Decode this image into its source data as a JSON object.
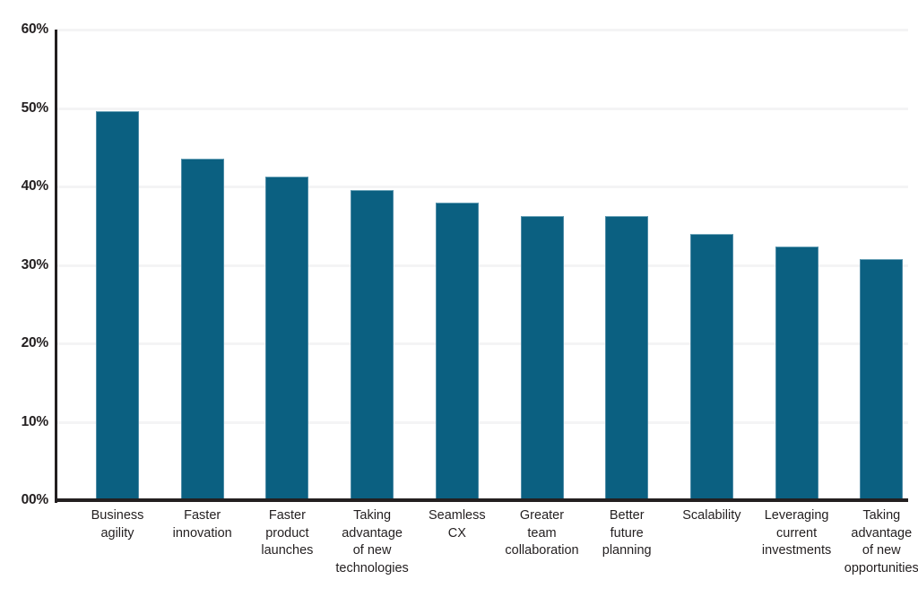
{
  "chart_data": {
    "type": "bar",
    "title": "",
    "subtitle": "",
    "xlabel": "",
    "ylabel": "",
    "ylim": [
      0,
      60
    ],
    "ytick_values": [
      0,
      10,
      20,
      30,
      40,
      50,
      60
    ],
    "ytick_labels": [
      "00%",
      "10%",
      "20%",
      "30%",
      "40%",
      "50%",
      "60%"
    ],
    "grid": true,
    "legend": false,
    "legend_position": "none",
    "orientation": "vertical",
    "bar_color": "#0b6081",
    "axis_color": "#231f20",
    "gridline_color": "#f4f4f5",
    "background_color": "#ffffff",
    "categories": [
      "Business agility",
      "Faster innovation",
      "Faster product launches",
      "Taking advantage of new technologies",
      "Seamless CX",
      "Greater team collaboration",
      "Better future planning",
      "Scalability",
      "Leveraging current investments",
      "Taking advantage of new opportunities"
    ],
    "category_lines": [
      [
        "Business",
        "agility"
      ],
      [
        "Faster",
        "innovation"
      ],
      [
        "Faster",
        "product",
        "launches"
      ],
      [
        "Taking",
        "advantage",
        "of new",
        "technologies"
      ],
      [
        "Seamless",
        "CX"
      ],
      [
        "Greater",
        "team",
        "collaboration"
      ],
      [
        "Better",
        "future",
        "planning"
      ],
      [
        "Scalability"
      ],
      [
        "Leveraging",
        "current",
        "investments"
      ],
      [
        "Taking",
        "advantage",
        "of new",
        "opportunities"
      ]
    ],
    "values": [
      49.6,
      43.6,
      41.3,
      39.6,
      38.0,
      36.2,
      36.2,
      34.0,
      32.4,
      30.8
    ],
    "value_labels": [
      "49.6%",
      "43.6%",
      "41.3%",
      "39.6%",
      "38.0%",
      "36.2%",
      "36.2%",
      "34.0%",
      "32.4%",
      "30.8%"
    ]
  }
}
